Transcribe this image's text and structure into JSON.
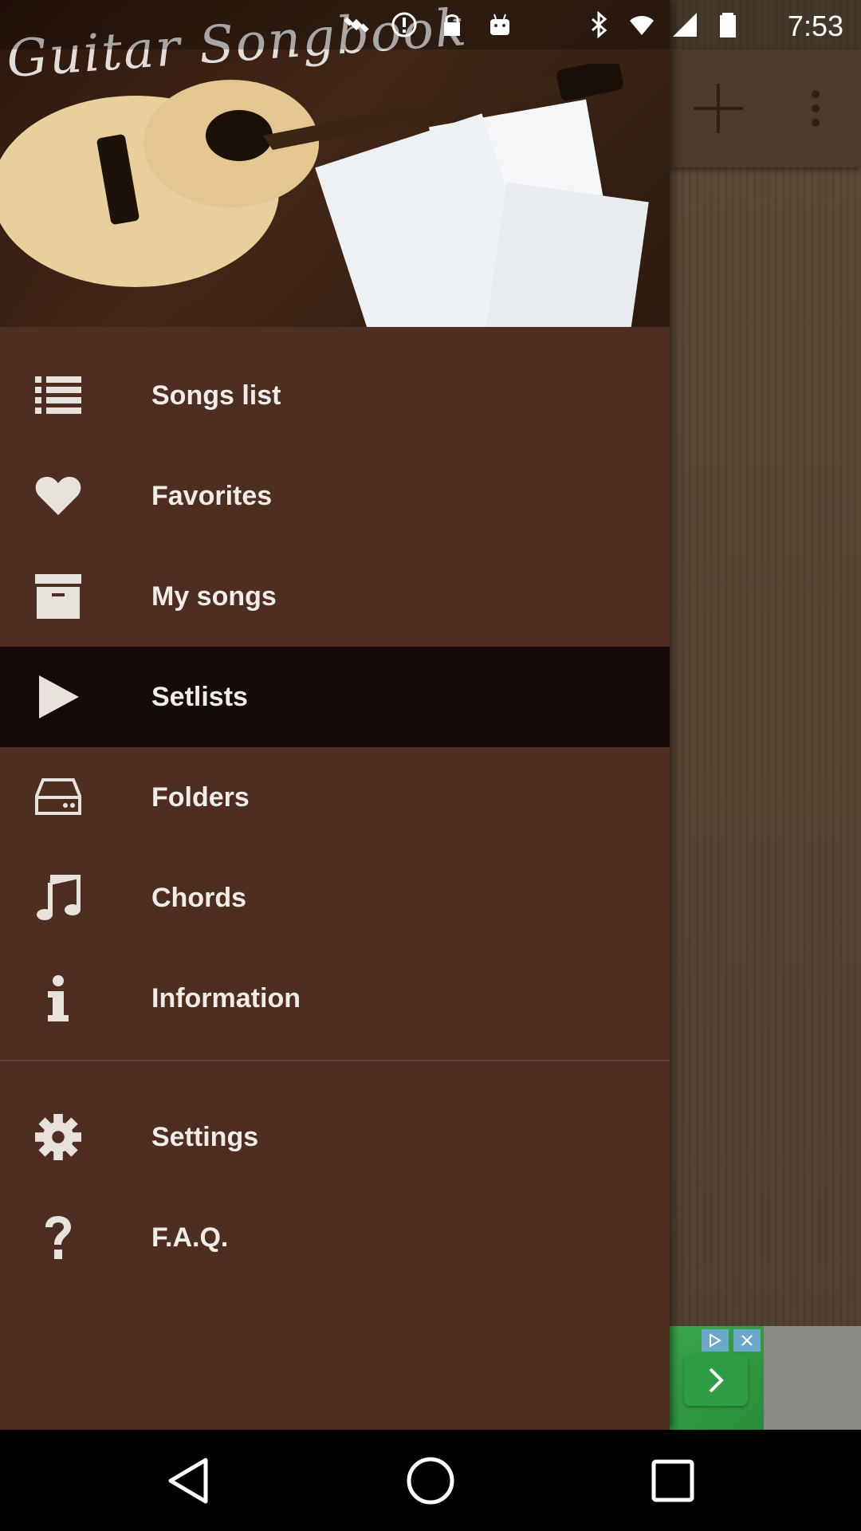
{
  "status_bar": {
    "time": "7:53"
  },
  "drawer": {
    "header_title": "Guitar Songbook",
    "items": [
      {
        "label": "Songs list",
        "icon": "list-icon"
      },
      {
        "label": "Favorites",
        "icon": "heart-icon"
      },
      {
        "label": "My songs",
        "icon": "archive-box-icon"
      },
      {
        "label": "Setlists",
        "icon": "play-icon",
        "active": true
      },
      {
        "label": "Folders",
        "icon": "drive-icon"
      },
      {
        "label": "Chords",
        "icon": "music-note-icon"
      },
      {
        "label": "Information",
        "icon": "info-icon"
      }
    ],
    "secondary_items": [
      {
        "label": "Settings",
        "icon": "gear-icon"
      },
      {
        "label": "F.A.Q.",
        "icon": "question-icon"
      }
    ]
  },
  "colors": {
    "drawer_bg": "#4e2e21",
    "active_bg": "#150b08",
    "text": "#f0ece8"
  }
}
